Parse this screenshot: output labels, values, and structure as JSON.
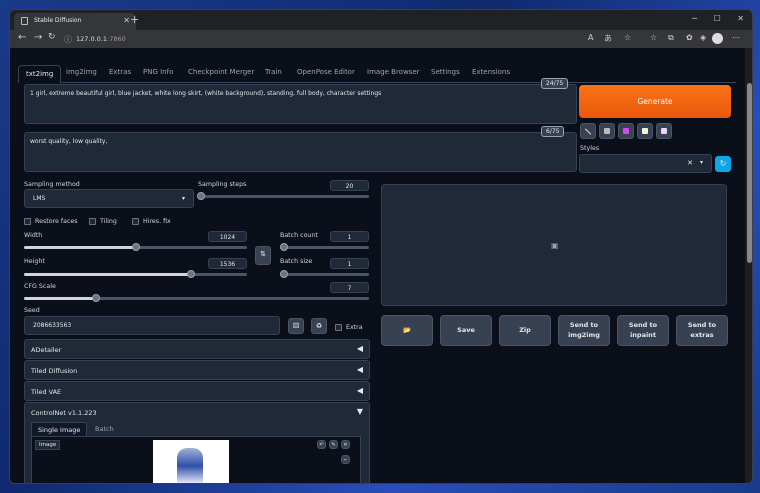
{
  "browser": {
    "tab_title": "Stable Diffusion",
    "url_host": "127.0.0.1",
    "url_port": ":7860",
    "new_tab": "+",
    "close": "✕",
    "win_min": "─",
    "win_max": "☐",
    "win_close": "✕"
  },
  "tabs": [
    "txt2img",
    "img2img",
    "Extras",
    "PNG Info",
    "Checkpoint Merger",
    "Train",
    "OpenPose Editor",
    "Image Browser",
    "Settings",
    "Extensions"
  ],
  "prompt": {
    "text": "1 girl, extreme beautiful girl, blue jacket, white long skirt, (white background), standing, full body, character settings",
    "counter": "24/75"
  },
  "negative": {
    "text": "worst quality, low quality,",
    "counter": "6/75"
  },
  "generate_label": "Generate",
  "styles_label": "Styles",
  "sampling": {
    "method_label": "Sampling method",
    "method": "LMS",
    "steps_label": "Sampling steps",
    "steps": "20",
    "steps_frac": 0.02
  },
  "options": {
    "restore": "Restore faces",
    "tiling": "Tiling",
    "hires": "Hires. fix"
  },
  "width": {
    "label": "Width",
    "value": "1024",
    "frac": 0.5
  },
  "height": {
    "label": "Height",
    "value": "1536",
    "frac": 0.75
  },
  "batch_count": {
    "label": "Batch count",
    "value": "1"
  },
  "batch_size": {
    "label": "Batch size",
    "value": "1"
  },
  "cfg": {
    "label": "CFG Scale",
    "value": "7",
    "frac": 0.21
  },
  "seed": {
    "label": "Seed",
    "value": "2086633563",
    "extra": "Extra"
  },
  "accordions": [
    "ADetailer",
    "Tiled Diffusion",
    "Tiled VAE",
    "ControlNet v1.1.223"
  ],
  "controlnet": {
    "tab_single": "Single Image",
    "tab_batch": "Batch",
    "image_label": "Image"
  },
  "actions": {
    "folder": "📂",
    "save": "Save",
    "zip": "Zip",
    "img2img": "Send to img2img",
    "inpaint": "Send to inpaint",
    "extras": "Send to extras"
  },
  "colors": {
    "accent": "#ea580c",
    "bg": "#0b0f19",
    "panel": "#1f2937"
  }
}
